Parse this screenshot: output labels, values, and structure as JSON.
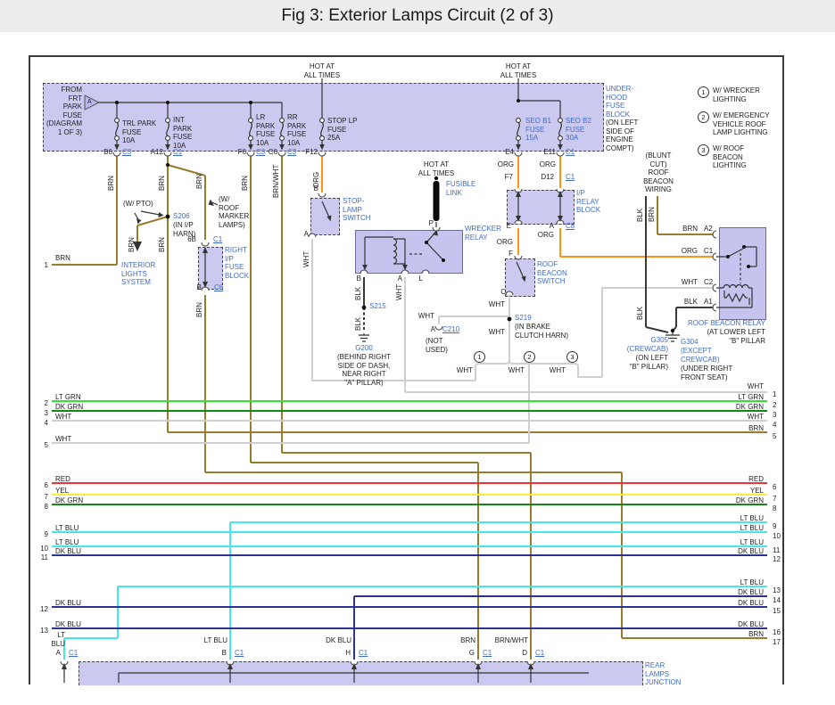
{
  "title": "Fig 3: Exterior Lamps Circuit (2 of 3)",
  "colors": {
    "titlebar": "#ededed",
    "boxfill": "#cbc9f0",
    "boxfill2": "#c6c4ee",
    "blue": "#3f6bc5",
    "brn": "#9a7b2b",
    "org": "#ff9314",
    "whtw": "#cfcfcf",
    "ltgrn": "#2ce82c",
    "dkgrn": "#128a12",
    "red": "#f53030",
    "yel": "#f7ed3a",
    "ltblu": "#45e8e8",
    "dkblu": "#2b3291"
  },
  "w": {
    "brn": "BRN",
    "brnwht": "BRN/WHT",
    "org": "ORG",
    "wht": "WHT",
    "blk": "BLK",
    "ltgrn": "LT GRN",
    "dkgrn": "DK GRN",
    "red": "RED",
    "yel": "YEL",
    "ltblu": "LT BLU",
    "ltblu2": "LT\nBLU",
    "dkblu": "DK BLU"
  },
  "top": {
    "from_fuse": "FROM\nFRT\nPARK\nFUSE\n(DIAGRAM\n1 OF 3)",
    "arrow": "A",
    "hot": "HOT AT\nALL TIMES",
    "fuse_trl": "TRL PARK\nFUSE\n10A",
    "fuse_int": "INT\nPARK\nFUSE\n10A",
    "fuse_lr": "LR\nPARK\nFUSE\n10A",
    "fuse_rr": "RR\nPARK\nFUSE\n10A",
    "fuse_stop": "STOP LP\nFUSE\n25A",
    "fuse_seo_b1": "SEO B1\nFUSE\n15A",
    "fuse_seo_b2": "SEO B2\nFUSE\n30A",
    "underhood": "UNDER-\nHOOD\nFUSE\nBLOCK",
    "underhood_loc": "(ON LEFT\nSIDE OF\nENGINE\nCOMPT)"
  },
  "pins": {
    "b6": "B6",
    "a12": "A12",
    "f6": "F6",
    "c6": "C6",
    "f12": "F12",
    "e4": "E4",
    "e11": "E11",
    "f7": "F7",
    "d12": "D12",
    "e": "E",
    "a": "A",
    "f": "F",
    "c": "C",
    "b": "B",
    "l": "L",
    "p": "P",
    "a2": "A2",
    "c1": "C1",
    "c2": "C2",
    "a1": "A1",
    "g": "G",
    "h": "H",
    "d": "D",
    "p6b": "6B"
  },
  "conn": {
    "c3": "C3",
    "c1": "C1",
    "c6": "C6",
    "c8": "C8",
    "c210": "C210"
  },
  "notes": {
    "d1": "1",
    "d2": "2",
    "d3": "3",
    "n1": "W/ WRECKER\nLIGHTING",
    "n2": "W/ EMERGENCY\nVEHICLE ROOF\nLAMP LIGHTING",
    "n3": "W/ ROOF\nBEACON\nLIGHTING",
    "blunt": "(BLUNT\nCUT)\nROOF\nBEACON\nWIRING"
  },
  "comp": {
    "stop_lamp": "STOP-\nLAMP\nSWITCH",
    "fusible": "FUSIBLE\nLINK",
    "wrecker": "WRECKER\nRELAY",
    "roof_sw": "ROOF\nBEACON\nSWITCH",
    "ip_relay": "I/P\nRELAY\nBLOCK",
    "right_ip": "RIGHT\nI/P\nFUSE\nBLOCK",
    "interior": "INTERIOR\nLIGHTS\nSYSTEM",
    "rear": "REAR\nLAMPS\nJUNCTION",
    "rbr": "ROOF BEACON RELAY",
    "rbr_loc": "(AT LOWER LEFT\n\"B\" PILLAR",
    "pto": "(W/ PTO)",
    "marker": "(W/\nROOF\nMARKER\nLAMPS)"
  },
  "ground": {
    "g200": "G200",
    "g200_loc": "(BEHIND RIGHT\nSIDE OF DASH,\nNEAR RIGHT\n\"A\" PILLAR)",
    "g305": "G305",
    "g305_a": "(CREWCAB)",
    "g305_loc": "(ON LEFT\n\"B\" PILLAR)",
    "g304": "G304",
    "g304_a": "(EXCEPT\nCREWCAB)",
    "g304_loc": "(UNDER RIGHT\nFRONT SEAT)"
  },
  "splice": {
    "s206": "S206",
    "s206_loc": "(IN I/P\nHARN)",
    "s215": "S215",
    "s219": "S219",
    "s219_loc": "(IN BRAKE\nCLUTCH HARN)",
    "c210_a": "A",
    "c210_loc": "(NOT\nUSED)"
  },
  "left_rows": [
    {
      "n": "1",
      "c": "BRN"
    },
    {
      "n": "2",
      "c": "LT GRN"
    },
    {
      "n": "3",
      "c": "DK GRN"
    },
    {
      "n": "4",
      "c": "WHT"
    },
    {
      "n": "5",
      "c": "WHT"
    },
    {
      "n": "6",
      "c": "RED"
    },
    {
      "n": "7",
      "c": "YEL"
    },
    {
      "n": "8",
      "c": "DK GRN"
    },
    {
      "n": "9",
      "c": "LT BLU"
    },
    {
      "n": "10",
      "c": "LT BLU"
    },
    {
      "n": "11",
      "c": "DK BLU"
    },
    {
      "n": "12",
      "c": "DK BLU"
    },
    {
      "n": "13",
      "c": "DK BLU"
    }
  ],
  "right_rows": [
    {
      "n": "1",
      "c": "WHT"
    },
    {
      "n": "2",
      "c": "LT GRN"
    },
    {
      "n": "3",
      "c": "DK GRN"
    },
    {
      "n": "4",
      "c": "WHT"
    },
    {
      "n": "5",
      "c": "BRN"
    },
    {
      "n": "6",
      "c": "RED"
    },
    {
      "n": "7",
      "c": "YEL"
    },
    {
      "n": "8",
      "c": "DK GRN"
    },
    {
      "n": "9",
      "c": "LT BLU"
    },
    {
      "n": "10",
      "c": "LT BLU"
    },
    {
      "n": "11",
      "c": "LT BLU"
    },
    {
      "n": "12",
      "c": "DK BLU"
    },
    {
      "n": "13",
      "c": "LT BLU"
    },
    {
      "n": "14",
      "c": "DK BLU"
    },
    {
      "n": "15",
      "c": "DK BLU"
    },
    {
      "n": "16",
      "c": "DK BLU"
    },
    {
      "n": "17",
      "c": "BRN"
    }
  ],
  "bottom_pins": [
    {
      "wire": "LT\nBLU",
      "pin": "A",
      "conn": "C1"
    },
    {
      "wire": "LT BLU",
      "pin": "B",
      "conn": "C1"
    },
    {
      "wire": "DK BLU",
      "pin": "H",
      "conn": "C1"
    },
    {
      "wire": "BRN",
      "pin": "G",
      "conn": "C1"
    },
    {
      "wire": "BRN/WHT",
      "pin": "D",
      "conn": "C1"
    }
  ]
}
